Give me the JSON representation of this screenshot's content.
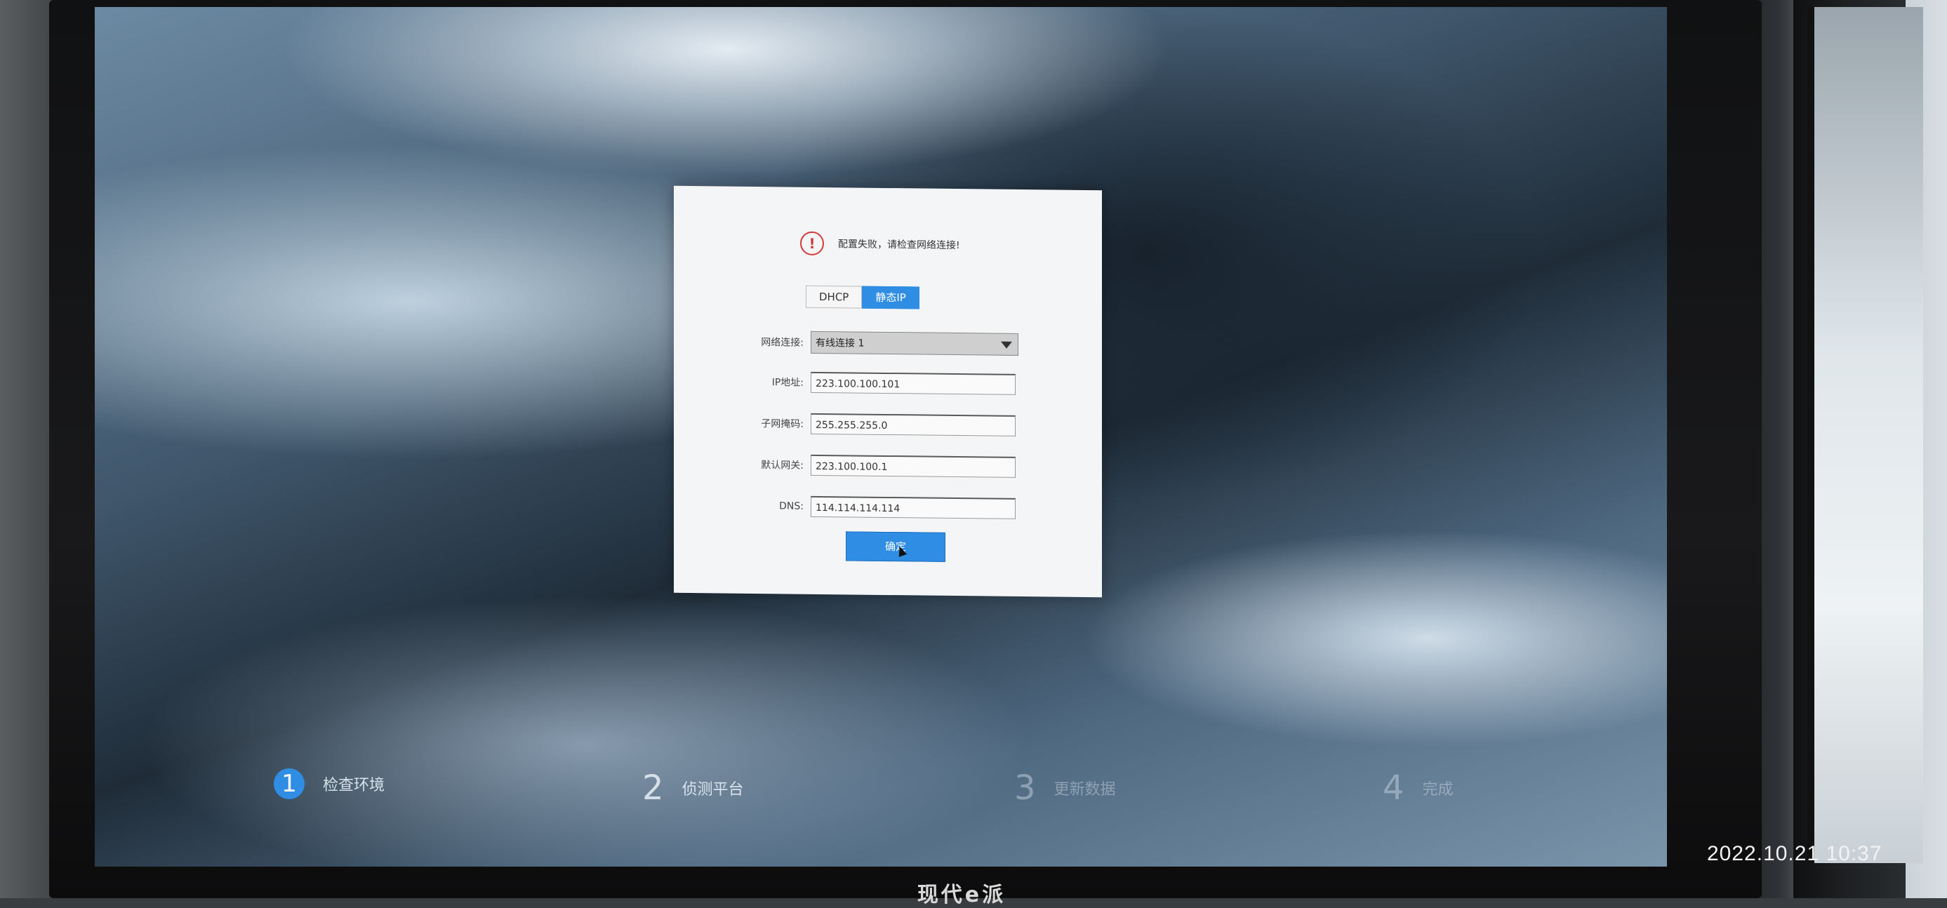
{
  "dialog": {
    "status_icon": "warning-icon",
    "status_text": "配置失败，请检查网络连接!",
    "tabs": [
      {
        "label": "DHCP",
        "active": false
      },
      {
        "label": "静态IP",
        "active": true
      }
    ],
    "fields": {
      "network_label": "网络连接:",
      "network_value": "有线连接 1",
      "ip_label": "IP地址:",
      "ip_value": "223.100.100.101",
      "subnet_label": "子网掩码:",
      "subnet_value": "255.255.255.0",
      "gateway_label": "默认网关:",
      "gateway_value": "223.100.100.1",
      "dns_label": "DNS:",
      "dns_value": "114.114.114.114"
    },
    "confirm_label": "确定"
  },
  "steps": [
    {
      "number": "1",
      "label": "检查环境",
      "active": true
    },
    {
      "number": "2",
      "label": "侦测平台",
      "active": false
    },
    {
      "number": "3",
      "label": "更新数据",
      "active": false
    },
    {
      "number": "4",
      "label": "完成",
      "active": false
    }
  ],
  "monitor": {
    "brand": "现代e派"
  },
  "photo": {
    "timestamp": "2022.10.21  10:37"
  },
  "colors": {
    "accent": "#2f8ee3",
    "warning": "#d23a3a"
  }
}
